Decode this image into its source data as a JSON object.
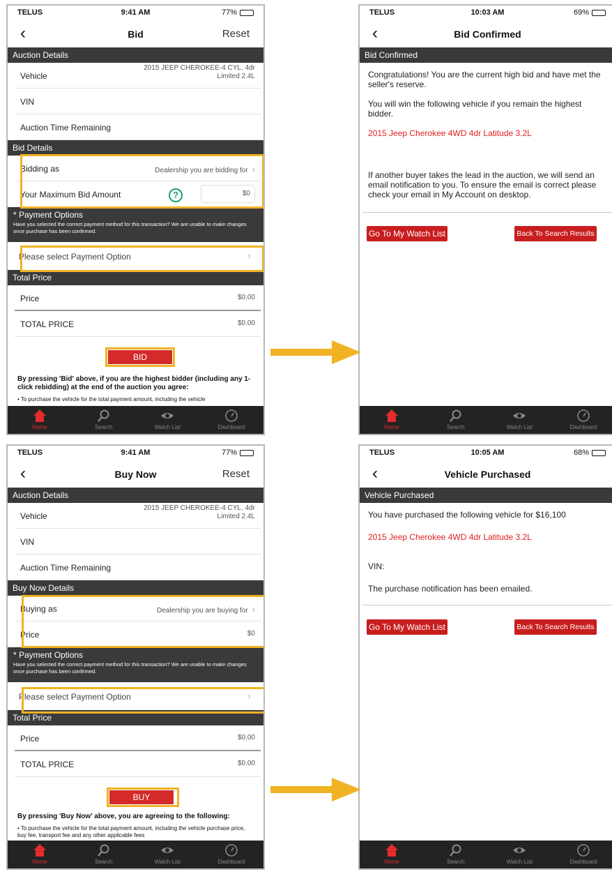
{
  "colors": {
    "accent_red": "#d42a2a",
    "highlight": "#f0b323",
    "section_bg": "#3a3a3a",
    "tabbar_bg": "#232323"
  },
  "tabbar": [
    {
      "label": "Home",
      "icon": "home-icon"
    },
    {
      "label": "Search",
      "icon": "search-icon"
    },
    {
      "label": "Watch List",
      "icon": "eye-icon"
    },
    {
      "label": "Dashboard",
      "icon": "gauge-icon"
    }
  ],
  "bid": {
    "status": {
      "carrier": "TELUS",
      "time": "9:41 AM",
      "battery": "77%"
    },
    "title": "Bid",
    "reset": "Reset",
    "auction_details_header": "Auction Details",
    "vehicle_label": "Vehicle",
    "vehicle_value_line1": "2015 JEEP CHEROKEE-4 CYL. 4dr",
    "vehicle_value_line2": "Limited 2.4L",
    "vin_label": "VIN",
    "time_remaining_label": "Auction Time Remaining",
    "details_header": "Bid Details",
    "bidding_as_label": "Bidding as",
    "bidding_as_value": "Dealership you are bidding for",
    "max_bid_label": "Your Maximum Bid Amount",
    "max_bid_value": "$0",
    "payment_header": "* Payment Options",
    "payment_note": "Have you selected the correct payment method for this transaction? We are unable to make changes once purchase has been confirmed.",
    "payment_select": "Please select Payment Option",
    "total_header": "Total Price",
    "price_label": "Price",
    "price_value": "$0.00",
    "total_label": "TOTAL PRICE",
    "total_value": "$0.00",
    "action_button": "BID",
    "fine_print": "By pressing 'Bid' above, if you are the highest bidder (including any 1-click rebidding) at the end of the auction you agree:",
    "fine_small": "• To purchase the vehicle for the total payment amount, including the vehicle"
  },
  "bid_confirmed": {
    "status": {
      "carrier": "TELUS",
      "time": "10:03 AM",
      "battery": "69%"
    },
    "title": "Bid Confirmed",
    "header": "Bid Confirmed",
    "para1": "Congratulations! You are the current high bid and have met the seller's reserve.",
    "para2": "You will win the following vehicle if you remain the highest bidder.",
    "vehicle": "2015 Jeep Cherokee 4WD 4dr Latitude 3.2L",
    "para3": "If another buyer takes the lead in the auction, we will send an email notification to you. To ensure the email is correct please check your email in My Account on desktop.",
    "btn_watch": "Go To My Watch List",
    "btn_search": "Back To Search Results"
  },
  "buy_now": {
    "status": {
      "carrier": "TELUS",
      "time": "9:41 AM",
      "battery": "77%"
    },
    "title": "Buy Now",
    "reset": "Reset",
    "auction_details_header": "Auction Details",
    "vehicle_label": "Vehicle",
    "vehicle_value_line1": "2015 JEEP CHEROKEE-4 CYL. 4dr",
    "vehicle_value_line2": "Limited 2.4L",
    "vin_label": "VIN",
    "time_remaining_label": "Auction Time Remaining",
    "details_header": "Buy Now Details",
    "buying_as_label": "Buying as",
    "buying_as_value": "Dealership you are buying for",
    "price_detail_label": "Price",
    "price_detail_value": "$0",
    "payment_header": "* Payment Options",
    "payment_note": "Have you selected the correct payment method for this transaction? We are unable to make changes once purchase has been confirmed.",
    "payment_select": "Please select Payment Option",
    "total_header": "Total Price",
    "price_label": "Price",
    "price_value": "$0.00",
    "total_label": "TOTAL PRICE",
    "total_value": "$0.00",
    "action_button": "BUY",
    "fine_print": "By pressing 'Buy Now' above, you are agreeing to the following:",
    "fine_small": "• To purchase the vehicle for the total payment amount, including the vehicle purchase price, buy fee, transport fee and any other applicable fees"
  },
  "vehicle_purchased": {
    "status": {
      "carrier": "TELUS",
      "time": "10:05 AM",
      "battery": "68%"
    },
    "title": "Vehicle Purchased",
    "header": "Vehicle Purchased",
    "para1": "You have purchased the following vehicle for $16,100",
    "vehicle": "2015 Jeep Cherokee 4WD 4dr Latitude 3.2L",
    "vin_label": "VIN:",
    "para2": "The purchase notification has been emailed.",
    "btn_watch": "Go To My Watch List",
    "btn_search": "Back To Search Results"
  }
}
